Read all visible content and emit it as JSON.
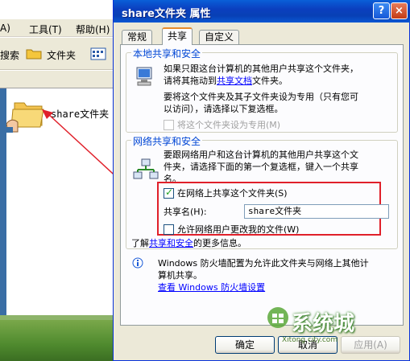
{
  "explorer": {
    "menu": [
      "A)",
      "工具(T)",
      "帮助(H)"
    ],
    "toolbar": {
      "search_label": "搜索",
      "folders_label": "文件夹"
    },
    "folder_label": "share文件夹"
  },
  "dialog": {
    "title": "share文件夹 属性",
    "help_button": "?",
    "close_button": "×",
    "tabs": [
      "常规",
      "共享",
      "自定义"
    ],
    "active_tab": "共享",
    "local": {
      "title": "本地共享和安全",
      "desc_prefix": "如果只跟这台计算机的其他用户共享这个文件夹，请将其拖动到",
      "desc_link": "共享文档",
      "desc_suffix": "文件夹。",
      "private_desc": "要将这个文件夹及其子文件夹设为专用（只有您可以访问），请选择以下复选框。",
      "private_checkbox": "将这个文件夹设为专用(M)"
    },
    "network": {
      "title": "网络共享和安全",
      "desc": "要跟网络用户和这台计算机的其他用户共享这个文件夹，请选择下面的第一个复选框，键入一个共享名。",
      "share_checkbox": "在网络上共享这个文件夹(S)",
      "share_checked": true,
      "share_name_label": "共享名(H):",
      "share_name_value": "share文件夹",
      "allow_change_checkbox": "允许网络用户更改我的文件(W)",
      "allow_change_checked": false,
      "learn_prefix": "了解",
      "learn_link": "共享和安全",
      "learn_suffix": "的更多信息。"
    },
    "firewall": {
      "desc": "Windows 防火墙配置为允许此文件夹与网络上其他计算机共享。",
      "link": "查看 Windows 防火墙设置"
    },
    "buttons": {
      "ok": "确定",
      "cancel": "取消",
      "apply": "应用(A)"
    }
  },
  "watermark": {
    "text": "系统城",
    "sub": "Xitong city.com"
  },
  "colors": {
    "title_bar": "#0b3fbf",
    "group_title": "#0046d5",
    "highlight": "#e0202a",
    "link": "#0000ff"
  }
}
